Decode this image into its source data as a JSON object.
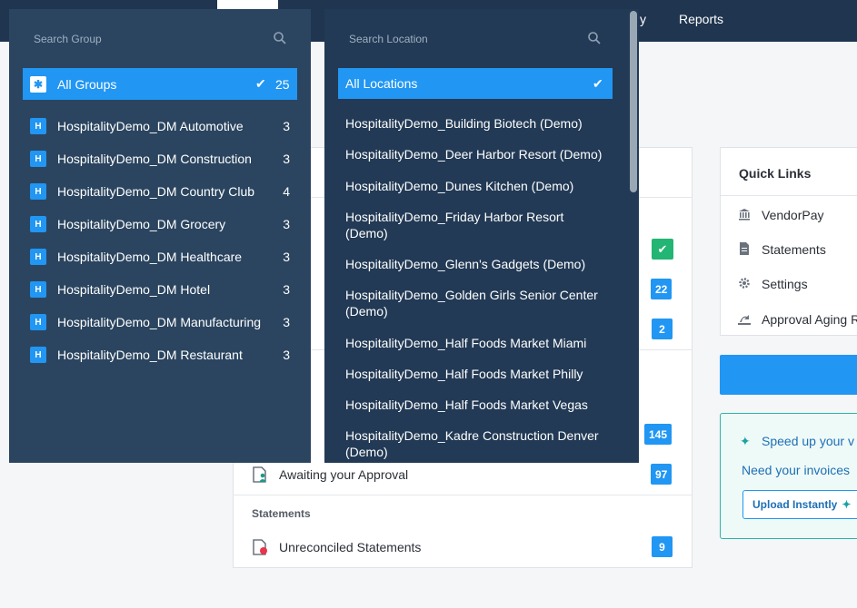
{
  "nav": {
    "partial_item": "y",
    "reports": "Reports"
  },
  "group_dropdown": {
    "placeholder": "Search Group",
    "all_label": "All Groups",
    "all_count": "25",
    "items": [
      {
        "badge": "H",
        "name": "HospitalityDemo_DM Automotive",
        "count": "3"
      },
      {
        "badge": "H",
        "name": "HospitalityDemo_DM Construction",
        "count": "3"
      },
      {
        "badge": "H",
        "name": "HospitalityDemo_DM Country Club",
        "count": "4"
      },
      {
        "badge": "H",
        "name": "HospitalityDemo_DM Grocery",
        "count": "3"
      },
      {
        "badge": "H",
        "name": "HospitalityDemo_DM Healthcare",
        "count": "3"
      },
      {
        "badge": "H",
        "name": "HospitalityDemo_DM Hotel",
        "count": "3"
      },
      {
        "badge": "H",
        "name": "HospitalityDemo_DM Manufacturing",
        "count": "3"
      },
      {
        "badge": "H",
        "name": "HospitalityDemo_DM Restaurant",
        "count": "3"
      }
    ]
  },
  "location_dropdown": {
    "placeholder": "Search Location",
    "all_label": "All Locations",
    "items": [
      "HospitalityDemo_Building Biotech (Demo)",
      "HospitalityDemo_Deer Harbor Resort (Demo)",
      "HospitalityDemo_Dunes Kitchen (Demo)",
      "HospitalityDemo_Friday Harbor Resort (Demo)",
      "HospitalityDemo_Glenn's Gadgets (Demo)",
      "HospitalityDemo_Golden Girls Senior Center (Demo)",
      "HospitalityDemo_Half Foods Market Miami",
      "HospitalityDemo_Half Foods Market Philly",
      "HospitalityDemo_Half Foods Market Vegas",
      "HospitalityDemo_Kadre Construction Denver (Demo)"
    ]
  },
  "tasks": {
    "badge_22": "22",
    "badge_2": "2",
    "badge_145": "145",
    "awaiting_label": "Awaiting your Approval",
    "awaiting_count": "97",
    "statements_title": "Statements",
    "unreconciled_label": "Unreconciled Statements",
    "unreconciled_count": "9"
  },
  "quick_links": {
    "title": "Quick Links",
    "items": [
      {
        "icon": "bank-icon",
        "label": "VendorPay"
      },
      {
        "icon": "document-icon",
        "label": "Statements"
      },
      {
        "icon": "gear-icon",
        "label": "Settings"
      },
      {
        "icon": "report-icon",
        "label": "Approval Aging R"
      }
    ]
  },
  "promo": {
    "title": "Speed up your v",
    "text": "Need your invoices",
    "button": "Upload Instantly"
  },
  "colors": {
    "nav": "#1f3550",
    "accent": "#2196f3",
    "success": "#22b573"
  }
}
